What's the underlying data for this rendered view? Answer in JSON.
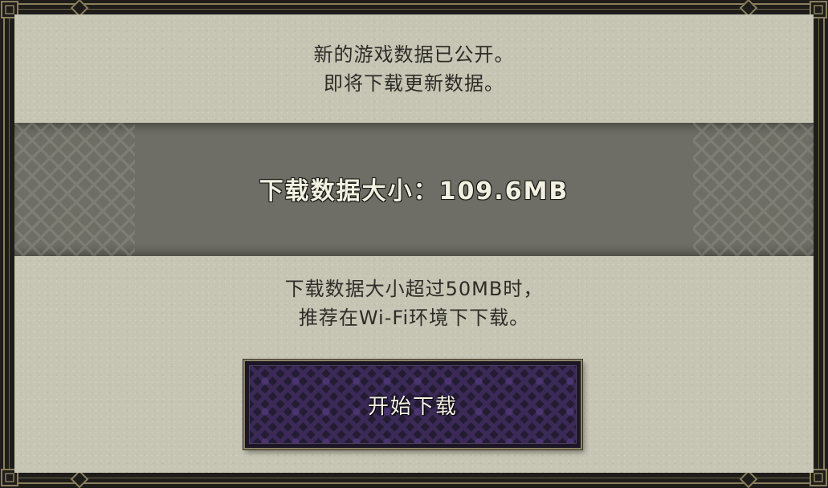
{
  "dialog": {
    "message_line1": "新的游戏数据已公开。",
    "message_line2": "即将下载更新数据。",
    "size_label": "下载数据大小：109.6MB",
    "note_line1": "下载数据大小超过50MB时，",
    "note_line2": "推荐在Wi-Fi环境下下载。",
    "button_label": "开始下载"
  },
  "colors": {
    "panel": "#c6c5b4",
    "band": "#6e6e66",
    "frame": "#1e1d1a",
    "frame_gold": "#8a7e5c",
    "button": "#241c33"
  },
  "icons": {
    "corners": "frame-corner-ornament",
    "edges": "frame-diamond-ornament"
  }
}
